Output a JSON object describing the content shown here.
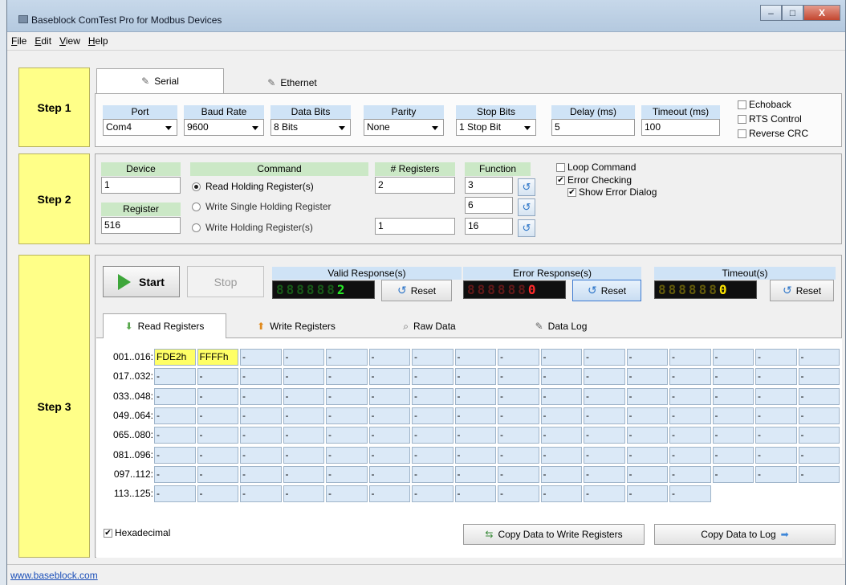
{
  "window": {
    "title": "Baseblock ComTest Pro for Modbus Devices",
    "min": "–",
    "max": "□",
    "close": "X"
  },
  "menu": [
    {
      "key": "F",
      "rest": "ile"
    },
    {
      "key": "E",
      "rest": "dit"
    },
    {
      "key": "V",
      "rest": "iew"
    },
    {
      "key": "H",
      "rest": "elp"
    }
  ],
  "steps": {
    "one": "Step 1",
    "two": "Step 2",
    "three": "Step 3"
  },
  "step1": {
    "tabs": {
      "serial": "Serial",
      "ethernet": "Ethernet"
    },
    "port": {
      "label": "Port",
      "value": "Com4"
    },
    "baud": {
      "label": "Baud Rate",
      "value": "9600"
    },
    "databits": {
      "label": "Data Bits",
      "value": "8 Bits"
    },
    "parity": {
      "label": "Parity",
      "value": "None"
    },
    "stopbits": {
      "label": "Stop Bits",
      "value": "1 Stop Bit"
    },
    "delay": {
      "label": "Delay (ms)",
      "value": "5"
    },
    "timeout": {
      "label": "Timeout (ms)",
      "value": "100"
    },
    "echoback": "Echoback",
    "rts": "RTS Control",
    "reverse_crc": "Reverse CRC"
  },
  "step2": {
    "device": {
      "label": "Device",
      "value": "1"
    },
    "register": {
      "label": "Register",
      "value": "516"
    },
    "command_label": "Command",
    "commands": [
      "Read Holding Register(s)",
      "Write Single Holding Register",
      "Write Holding Register(s)"
    ],
    "registers": {
      "label": "# Registers",
      "value1": "2",
      "value3": "1"
    },
    "function": {
      "label": "Function",
      "values": [
        "3",
        "6",
        "16"
      ]
    },
    "loop": "Loop Command",
    "error_checking": "Error Checking",
    "show_error": "Show Error Dialog",
    "check": "✔"
  },
  "step3": {
    "start": "Start",
    "stop": "Stop",
    "valid": {
      "label": "Valid Response(s)",
      "display": "8888882"
    },
    "error": {
      "label": "Error Response(s)",
      "display": "8888880"
    },
    "timeout": {
      "label": "Timeout(s)",
      "display": "8888880"
    },
    "reset": "Reset",
    "tabs": [
      "Read Registers",
      "Write Registers",
      "Raw Data",
      "Data Log"
    ],
    "rows": [
      "001..016:",
      "017..032:",
      "033..048:",
      "049..064:",
      "065..080:",
      "081..096:",
      "097..112:",
      "113..125:"
    ],
    "first_values": [
      "FDE2h",
      "FFFFh"
    ],
    "empty": "-",
    "hexadecimal": "Hexadecimal",
    "copy_write": "Copy Data to Write Registers",
    "copy_log": "Copy Data to Log"
  },
  "status": {
    "link": "www.baseblock.com"
  },
  "colors": {
    "step": "#ffff88",
    "label_blue": "#cfe3f6",
    "label_green": "#cbe8c6",
    "cell": "#dbe9f7",
    "highlight": "#ffff66",
    "lcd_green": "#27e827",
    "lcd_red": "#ff2a2a",
    "lcd_yellow": "#ffe600"
  }
}
